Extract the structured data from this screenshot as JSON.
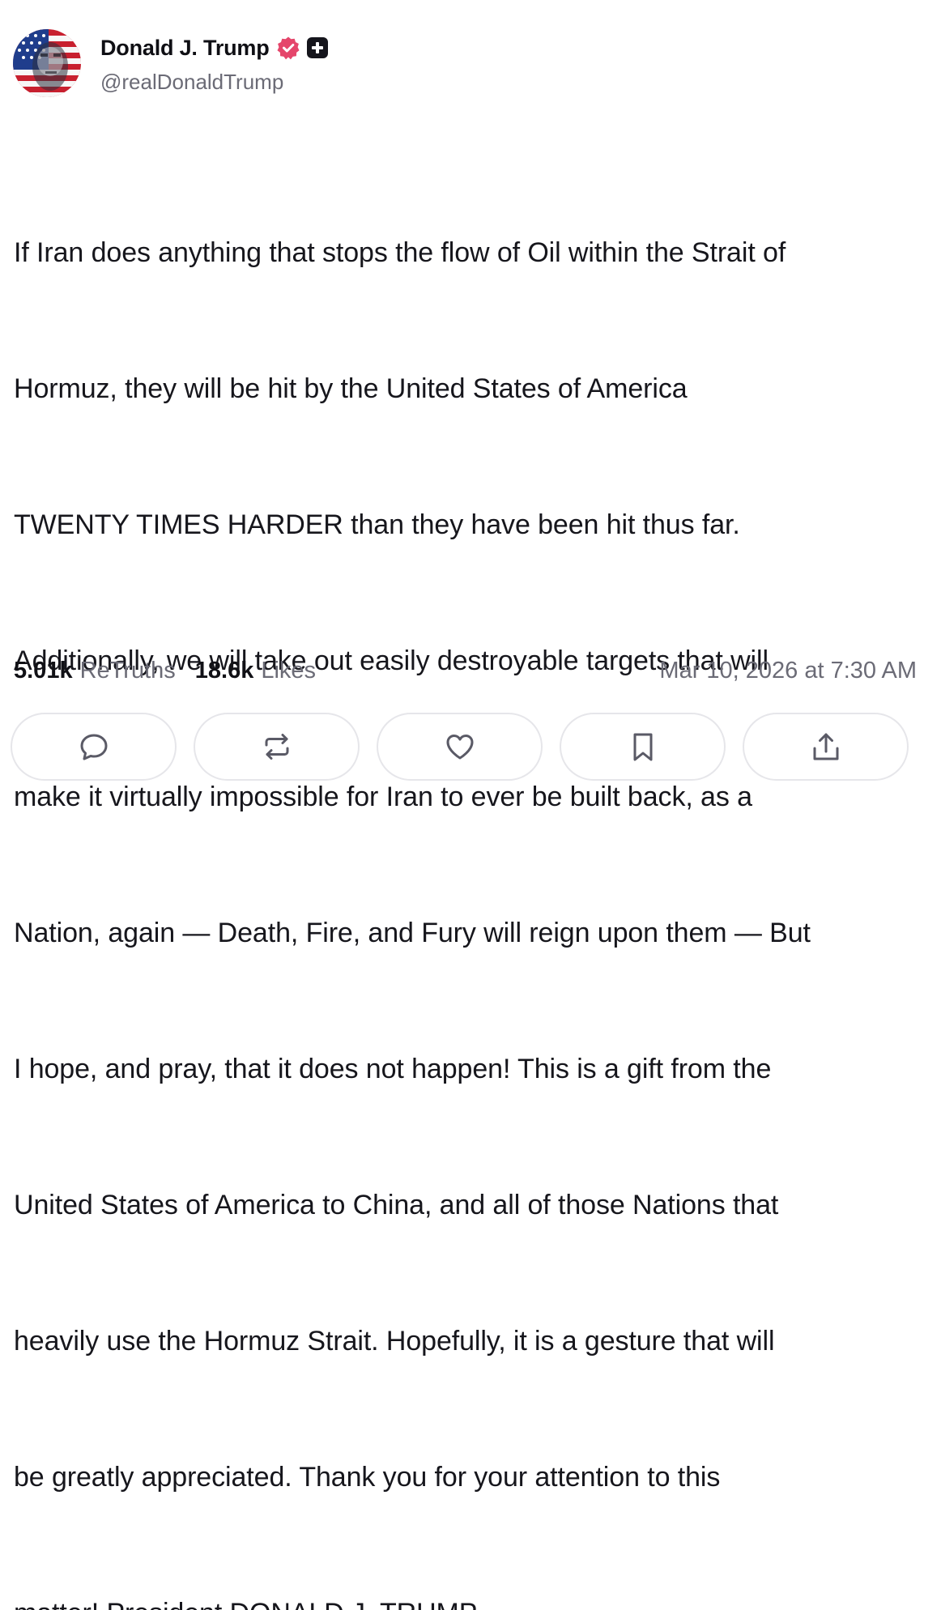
{
  "author": {
    "display_name": "Donald J. Trump",
    "handle": "@realDonaldTrump",
    "avatar_icon": "flag-portrait-avatar",
    "verified_icon": "verified-badge-icon",
    "verified_color": "#e5466b",
    "plus_badge_icon": "plus-badge-icon"
  },
  "post": {
    "text_lines": [
      "If Iran does anything that stops the flow of Oil within the Strait of",
      "Hormuz, they will be hit by the United States of America",
      "TWENTY TIMES HARDER than they have been hit thus far.",
      "Additionally, we will take out easily destroyable targets that will",
      "make it virtually impossible for Iran to ever be built back, as a",
      "Nation, again — Death, Fire, and Fury will reign upon them — But",
      "I hope, and pray, that it does not happen! This is a gift from the",
      "United States of America to China, and all of those Nations that",
      "heavily use the Hormuz Strait. Hopefully, it is a gesture that will",
      "be greatly appreciated. Thank you for your attention to this",
      "matter! President DONALD J. TRUMP"
    ]
  },
  "stats": {
    "retruths_count": "5.01k",
    "retruths_label": "ReTruths",
    "likes_count": "18.6k",
    "likes_label": "Likes",
    "timestamp": "Mar 10, 2026 at 7:30 AM"
  },
  "actions": [
    {
      "icon": "reply-icon"
    },
    {
      "icon": "retruth-icon"
    },
    {
      "icon": "like-heart-icon"
    },
    {
      "icon": "bookmark-icon"
    },
    {
      "icon": "share-icon"
    }
  ],
  "colors": {
    "text_primary": "#16161c",
    "text_secondary": "#6b6b76",
    "button_border": "#e6e6ea",
    "icon_color": "#5a5a66"
  }
}
